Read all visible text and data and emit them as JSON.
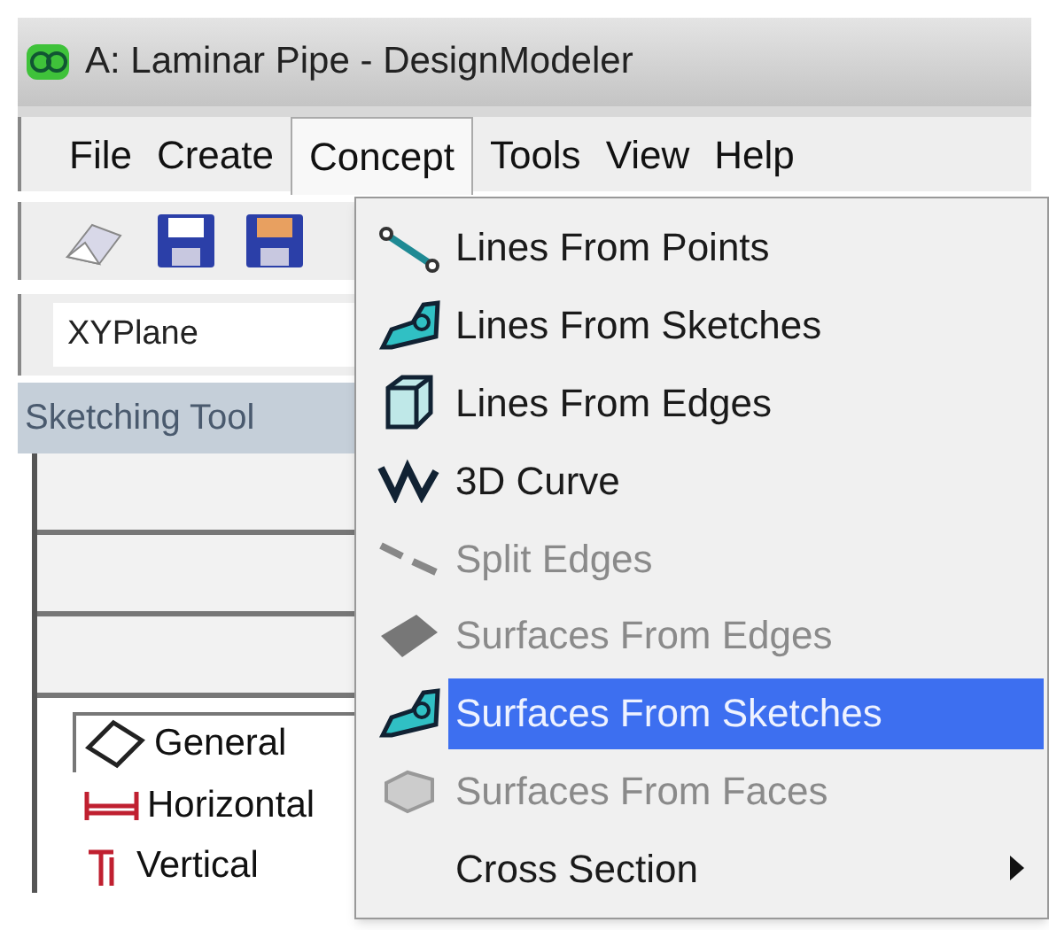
{
  "window": {
    "title": "A: Laminar Pipe - DesignModeler"
  },
  "menu_bar": [
    {
      "label": "File",
      "selected": false
    },
    {
      "label": "Create",
      "selected": false
    },
    {
      "label": "Concept",
      "selected": true
    },
    {
      "label": "Tools",
      "selected": false
    },
    {
      "label": "View",
      "selected": false
    },
    {
      "label": "Help",
      "selected": false
    }
  ],
  "plane_field": {
    "value": "XYPlane"
  },
  "panel": {
    "title": "Sketching Tool"
  },
  "toolbox": [
    {
      "label": "General",
      "selected": true
    },
    {
      "label": "Horizontal",
      "selected": false
    },
    {
      "label": "Vertical",
      "selected": false
    }
  ],
  "concept_menu": [
    {
      "label": "Lines From Points",
      "kind": "points",
      "disabled": false,
      "selected": false,
      "submenu": false
    },
    {
      "label": "Lines From Sketches",
      "kind": "sketch",
      "disabled": false,
      "selected": false,
      "submenu": false
    },
    {
      "label": "Lines From Edges",
      "kind": "cube",
      "disabled": false,
      "selected": false,
      "submenu": false
    },
    {
      "label": "3D Curve",
      "kind": "curve",
      "disabled": false,
      "selected": false,
      "submenu": false
    },
    {
      "label": "Split Edges",
      "kind": "split",
      "disabled": true,
      "selected": false,
      "submenu": false
    },
    {
      "label": "Surfaces From Edges",
      "kind": "plate",
      "disabled": true,
      "selected": false,
      "submenu": false
    },
    {
      "label": "Surfaces From Sketches",
      "kind": "sketch",
      "disabled": false,
      "selected": true,
      "submenu": false
    },
    {
      "label": "Surfaces From Faces",
      "kind": "faces",
      "disabled": true,
      "selected": false,
      "submenu": false
    },
    {
      "label": "Cross Section",
      "kind": "none",
      "disabled": false,
      "selected": false,
      "submenu": true
    }
  ]
}
